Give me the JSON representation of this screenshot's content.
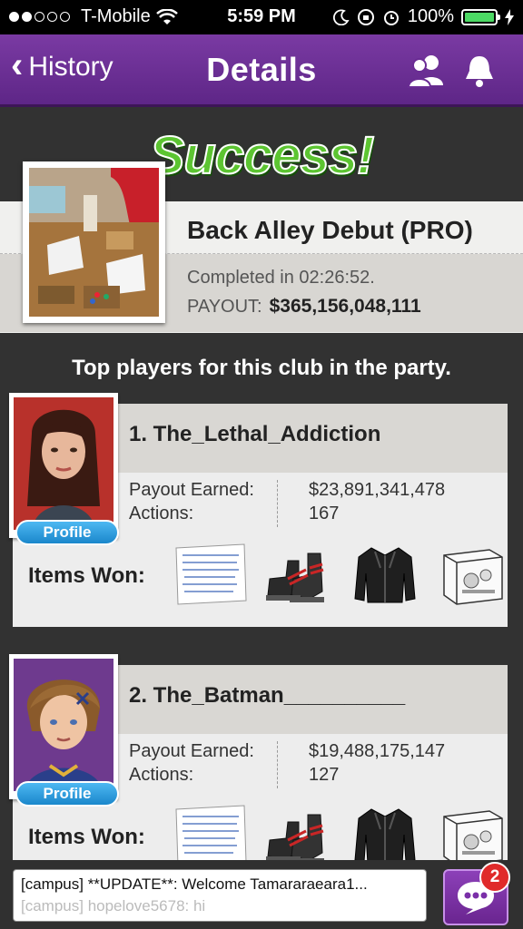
{
  "status_bar": {
    "carrier": "T-Mobile",
    "time": "5:59 PM",
    "battery": "100%",
    "signal_bars_filled": 2,
    "signal_bars_total": 5
  },
  "nav": {
    "back_label": "History",
    "title": "Details",
    "icons": [
      "friends-icon",
      "bell-icon"
    ],
    "accent_color": "#6a2c94"
  },
  "result": {
    "banner": "Success!",
    "club_name": "Back Alley Debut (PRO)",
    "completed": "Completed in 02:26:52.",
    "payout_label": "PAYOUT:",
    "payout_value": "$365,156,048,111"
  },
  "top_players_heading": "Top players for this club in the party.",
  "players": [
    {
      "name": "1. The_Lethal_Addiction",
      "payout_label": "Payout Earned:",
      "payout_value": "$23,891,341,478",
      "actions_label": "Actions:",
      "actions_value": "167",
      "profile_label": "Profile",
      "items_label": "Items Won:",
      "items": [
        "paper-note-icon",
        "boots-icon",
        "leather-jacket-icon",
        "display-case-icon"
      ]
    },
    {
      "name": "2. The_Batman__________",
      "payout_label": "Payout Earned:",
      "payout_value": "$19,488,175,147",
      "actions_label": "Actions:",
      "actions_value": "127",
      "profile_label": "Profile",
      "items_label": "Items Won:",
      "items": [
        "paper-note-icon",
        "boots-icon",
        "leather-jacket-icon",
        "display-case-icon"
      ]
    }
  ],
  "chat": {
    "line1": "[campus] **UPDATE**: Welcome Tamararaeara1...",
    "line2": "[campus] hopelove5678: hi",
    "badge": "2"
  }
}
